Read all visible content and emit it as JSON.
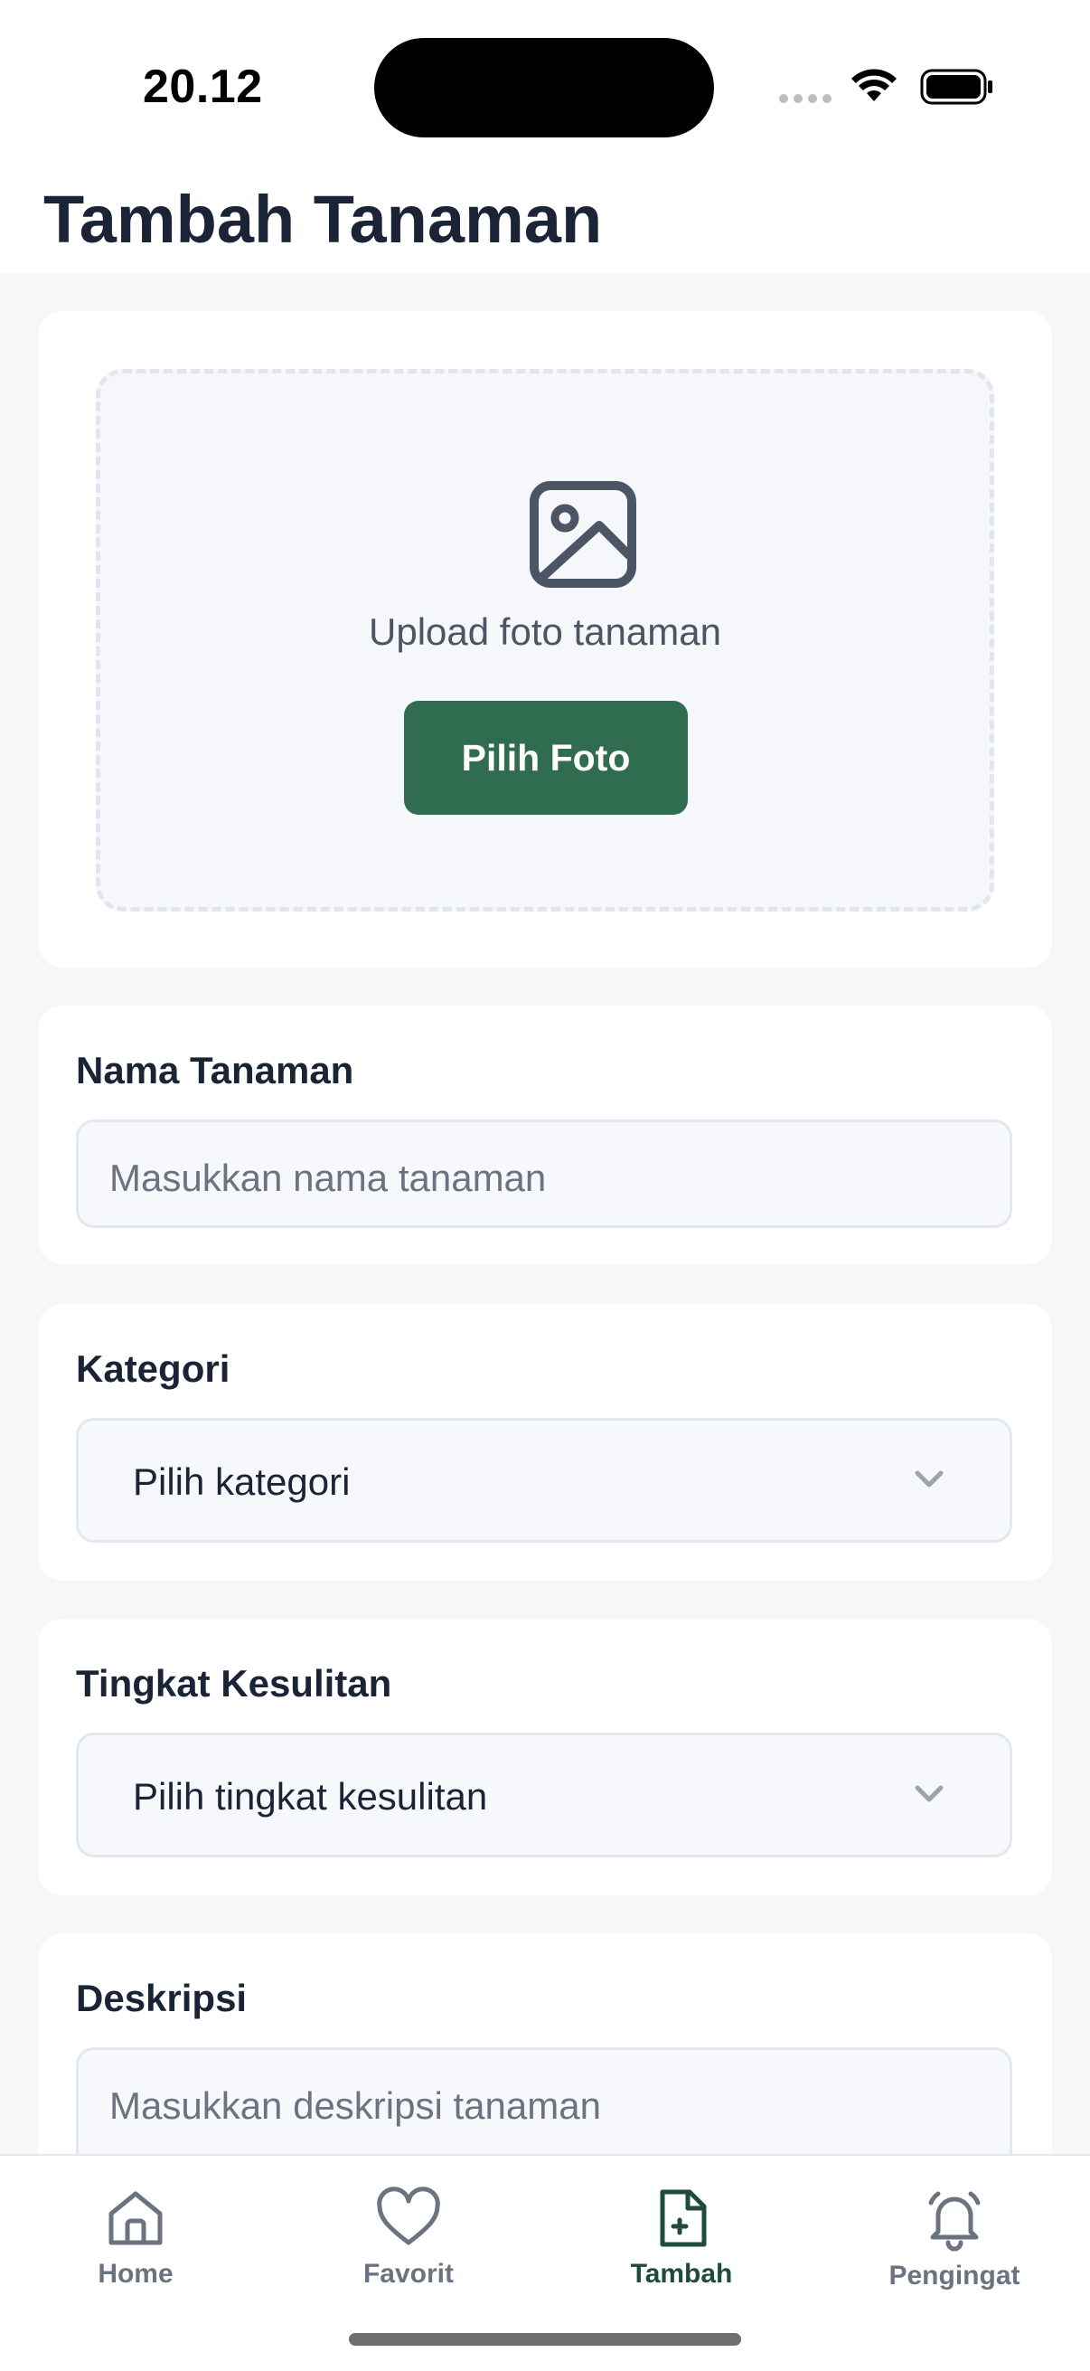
{
  "status_bar": {
    "time": "20.12"
  },
  "header": {
    "title": "Tambah Tanaman"
  },
  "upload": {
    "text": "Upload foto tanaman",
    "button_label": "Pilih Foto"
  },
  "form": {
    "name": {
      "label": "Nama Tanaman",
      "placeholder": "Masukkan nama tanaman"
    },
    "category": {
      "label": "Kategori",
      "value": "Pilih kategori"
    },
    "difficulty": {
      "label": "Tingkat Kesulitan",
      "value": "Pilih tingkat kesulitan"
    },
    "description": {
      "label": "Deskripsi",
      "placeholder": "Masukkan deskripsi tanaman"
    }
  },
  "tabs": [
    {
      "label": "Home",
      "icon": "home-icon",
      "active": false
    },
    {
      "label": "Favorit",
      "icon": "heart-icon",
      "active": false
    },
    {
      "label": "Tambah",
      "icon": "file-add-icon",
      "active": true
    },
    {
      "label": "Pengingat",
      "icon": "bell-icon",
      "active": false
    }
  ],
  "colors": {
    "accent": "#306c50",
    "active_tab": "#1f4b39",
    "background": "#f6f8f8"
  }
}
